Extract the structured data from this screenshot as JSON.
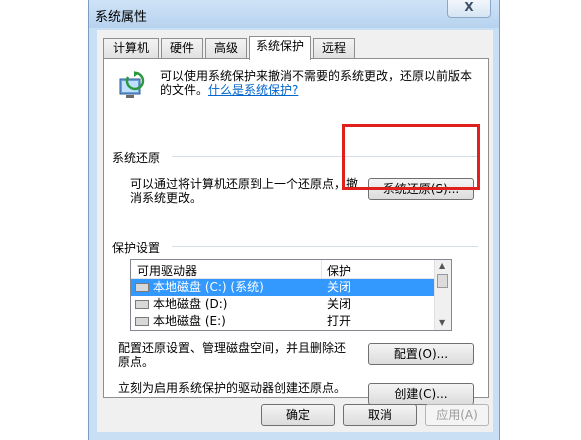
{
  "window": {
    "title": "系统属性",
    "close_glyph": "X"
  },
  "tabs": [
    {
      "label": "计算机名"
    },
    {
      "label": "硬件"
    },
    {
      "label": "高级"
    },
    {
      "label": "系统保护"
    },
    {
      "label": "远程"
    }
  ],
  "active_tab": "系统保护",
  "intro": {
    "text": "可以使用系统保护来撤消不需要的系统更改，还原以前版本的文件。",
    "link": "什么是系统保护?"
  },
  "restore": {
    "group_title": "系统还原",
    "description": "可以通过将计算机还原到上一个还原点，撤消系统更改。",
    "button": "系统还原(S)..."
  },
  "protection": {
    "group_title": "保护设置",
    "columns": [
      "可用驱动器",
      "保护"
    ],
    "drives": [
      {
        "name": "本地磁盘 (C:) (系统)",
        "protection": "关闭",
        "selected": true
      },
      {
        "name": "本地磁盘 (D:)",
        "protection": "关闭",
        "selected": false
      },
      {
        "name": "本地磁盘 (E:)",
        "protection": "打开",
        "selected": false
      }
    ],
    "config_text": "配置还原设置、管理磁盘空间，并且删除还原点。",
    "config_button": "配置(O)...",
    "create_text": "立刻为启用系统保护的驱动器创建还原点。",
    "create_button": "创建(C)..."
  },
  "footer": {
    "ok": "确定",
    "cancel": "取消",
    "apply": "应用(A)"
  },
  "colors": {
    "selection": "#3399ff",
    "highlight_box": "#e0201c",
    "link": "#0066cc"
  }
}
